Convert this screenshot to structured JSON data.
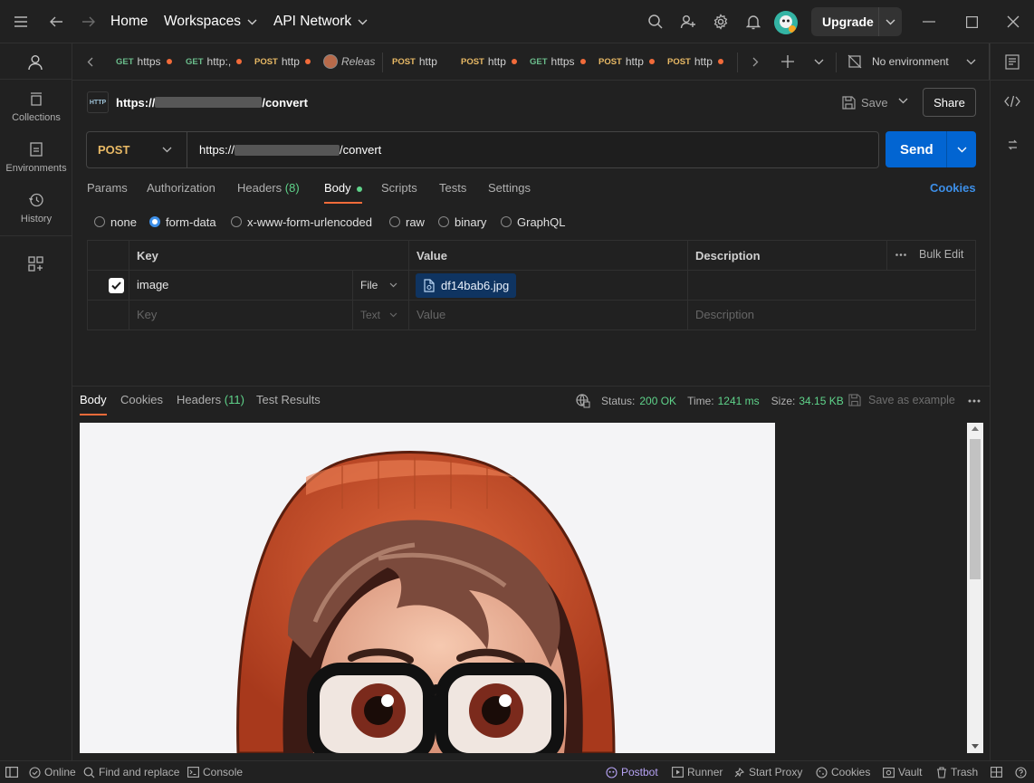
{
  "titlebar": {
    "home": "Home",
    "workspaces": "Workspaces",
    "api_network": "API Network",
    "upgrade": "Upgrade",
    "icons": [
      "menu-icon",
      "back-arrow-icon",
      "forward-arrow-icon",
      "search-icon",
      "invite-user-icon",
      "settings-gear-icon",
      "notification-bell-icon",
      "avatar",
      "chevron-down-icon",
      "minimize-icon",
      "maximize-icon",
      "close-icon"
    ]
  },
  "sidebar": {
    "items": [
      {
        "label": "Collections",
        "icon": "collections-icon"
      },
      {
        "label": "Environments",
        "icon": "environments-icon"
      },
      {
        "label": "History",
        "icon": "history-icon"
      }
    ]
  },
  "tabs": [
    {
      "method": "GET",
      "label": "https"
    },
    {
      "method": "GET",
      "label": "http:,"
    },
    {
      "method": "POST",
      "label": "http"
    },
    {
      "method": "",
      "label": "Releas"
    },
    {
      "method": "POST",
      "label": "http"
    },
    {
      "method": "POST",
      "label": "http"
    },
    {
      "method": "GET",
      "label": "https"
    },
    {
      "method": "POST",
      "label": "http"
    },
    {
      "method": "POST",
      "label": "http"
    }
  ],
  "environment": {
    "label": "No environment"
  },
  "request": {
    "title_prefix": "https://",
    "title_suffix": "/convert",
    "save": "Save",
    "share": "Share",
    "method": "POST",
    "url_prefix": "https://",
    "url_suffix": "/convert",
    "send": "Send"
  },
  "request_tabs": {
    "params": "Params",
    "authorization": "Authorization",
    "headers": "Headers",
    "headers_count": "(8)",
    "body": "Body",
    "scripts": "Scripts",
    "tests": "Tests",
    "settings": "Settings",
    "cookies": "Cookies"
  },
  "body_types": [
    "none",
    "form-data",
    "x-www-form-urlencoded",
    "raw",
    "binary",
    "GraphQL"
  ],
  "body_type_selected": "form-data",
  "form_table": {
    "columns": [
      "Key",
      "Value",
      "Description"
    ],
    "bulk_edit": "Bulk Edit",
    "rows": [
      {
        "key": "image",
        "type": "File",
        "value": "df14bab6.jpg",
        "description": "",
        "checked": true
      }
    ],
    "placeholder": {
      "key": "Key",
      "type": "Text",
      "value": "Value",
      "description": "Description"
    }
  },
  "response": {
    "tabs": {
      "body": "Body",
      "cookies": "Cookies",
      "headers": "Headers",
      "headers_count": "(11)",
      "test_results": "Test Results"
    },
    "status_label": "Status:",
    "status_value": "200 OK",
    "time_label": "Time:",
    "time_value": "1241 ms",
    "size_label": "Size:",
    "size_value": "34.15 KB",
    "save_example": "Save as example"
  },
  "statusbar": {
    "online": "Online",
    "find_replace": "Find and replace",
    "console": "Console",
    "postbot": "Postbot",
    "runner": "Runner",
    "start_proxy": "Start Proxy",
    "cookies": "Cookies",
    "vault": "Vault",
    "trash": "Trash"
  },
  "colors": {
    "background": "#212121",
    "accent_blue": "#0265d2",
    "link_blue": "#3d8fe8",
    "status_green": "#5fd38a",
    "post_orange": "#e8b965",
    "get_green": "#6bbd8c",
    "unsaved_dot": "#f26b3a",
    "active_underline": "#f26b3a"
  }
}
